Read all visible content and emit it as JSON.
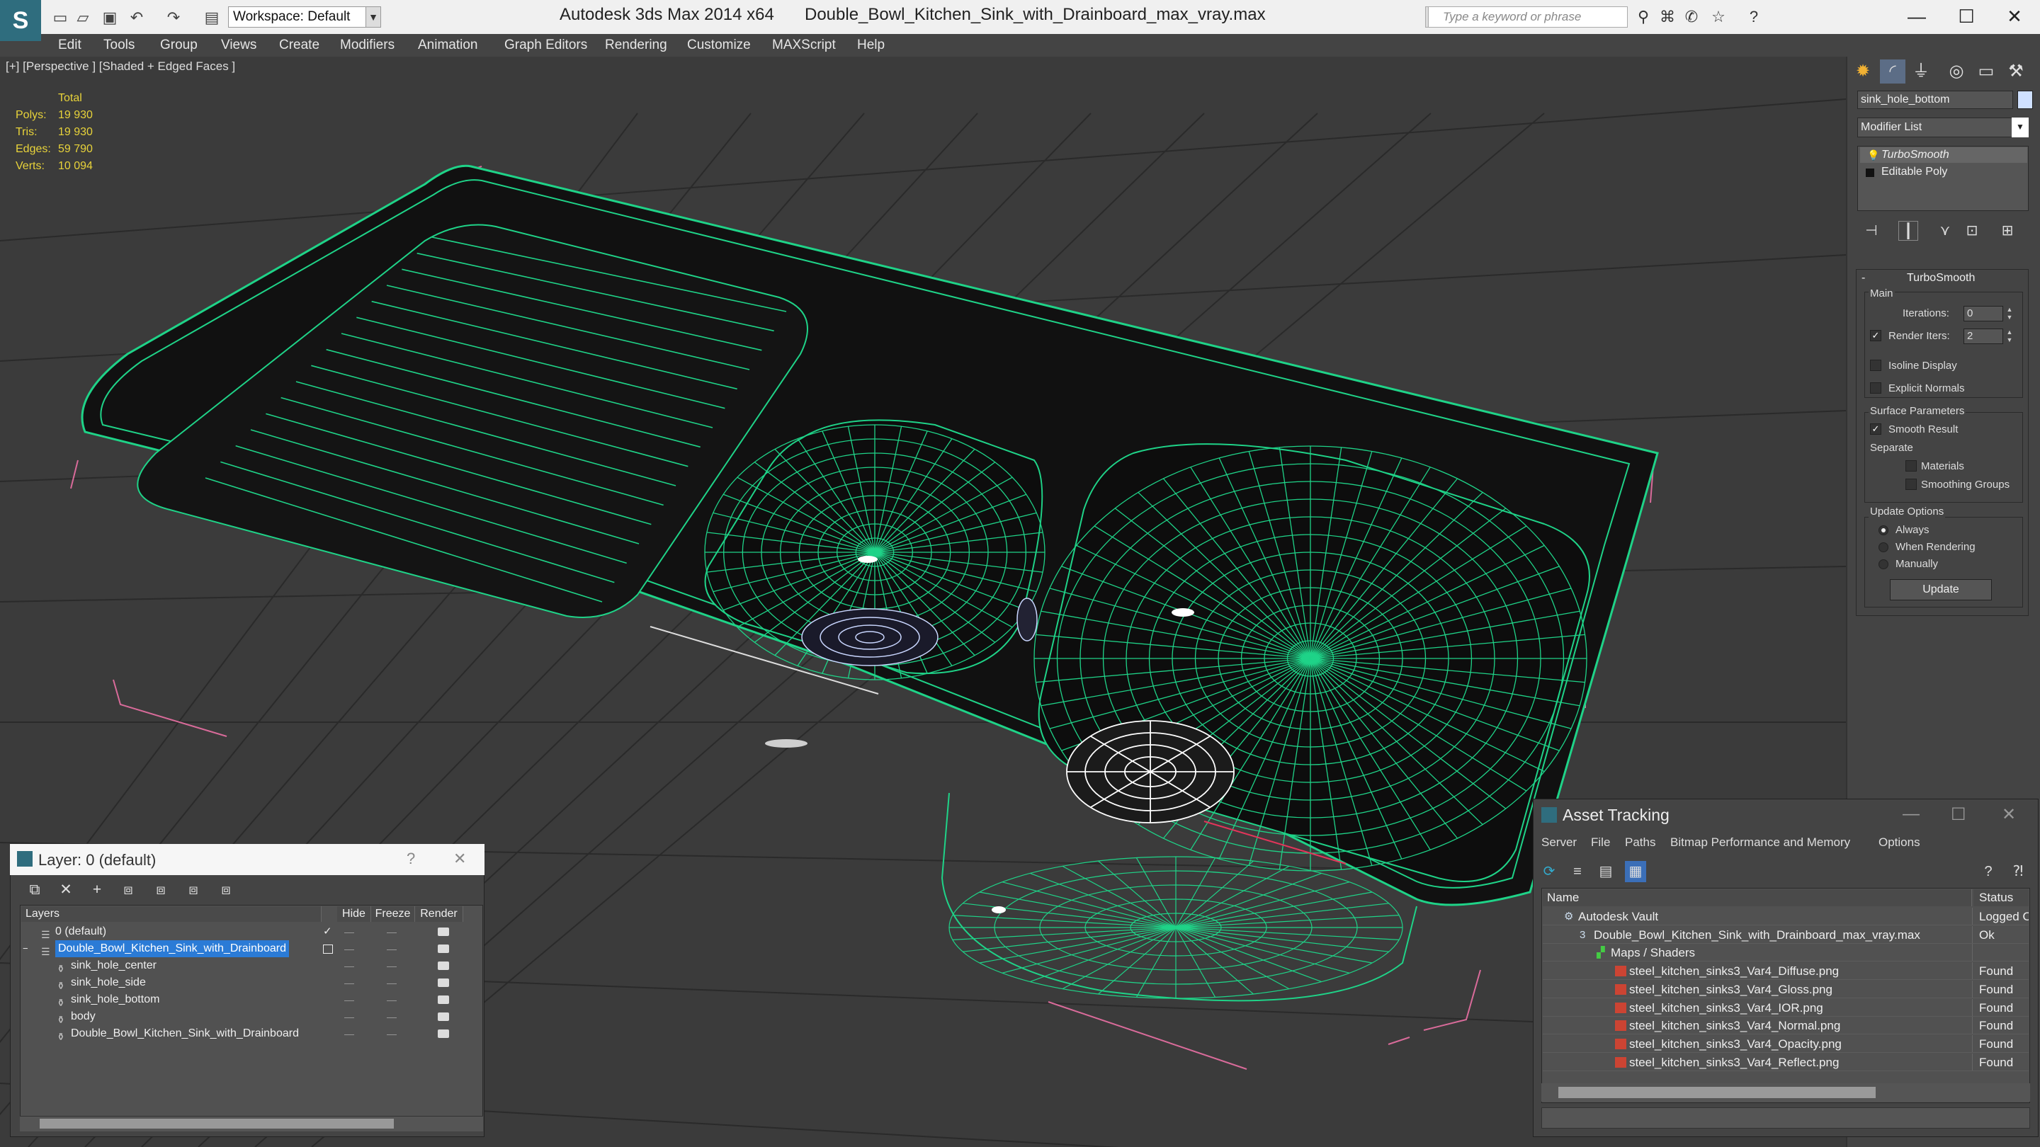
{
  "titlebar": {
    "app_title": "Autodesk 3ds Max  2014 x64",
    "doc_title": "Double_Bowl_Kitchen_Sink_with_Drainboard_max_vray.max",
    "workspace": "Workspace: Default",
    "search_placeholder": "Type a keyword or phrase",
    "logo": "S"
  },
  "menu": [
    "Edit",
    "Tools",
    "Group",
    "Views",
    "Create",
    "Modifiers",
    "Animation",
    "Graph Editors",
    "Rendering",
    "Customize",
    "MAXScript",
    "Help"
  ],
  "viewport": {
    "label": "[+] [Perspective ] [Shaded + Edged Faces ]",
    "stats_header": "Total",
    "stats": [
      {
        "label": "Polys:",
        "value": "19 930"
      },
      {
        "label": "Tris:",
        "value": "19 930"
      },
      {
        "label": "Edges:",
        "value": "59 790"
      },
      {
        "label": "Verts:",
        "value": "10 094"
      }
    ],
    "wire_color": "#1fd388",
    "grid_color": "#2a2a2a",
    "bbox_color": "#d96b9a"
  },
  "command_panel": {
    "object_name": "sink_hole_bottom",
    "modifier_list": "Modifier List",
    "stack": [
      "TurboSmooth",
      "Editable Poly"
    ],
    "rollout_title": "TurboSmooth",
    "main_label": "Main",
    "iterations_label": "Iterations:",
    "iterations_value": "0",
    "render_iters_label": "Render Iters:",
    "render_iters_value": "2",
    "isoline_label": "Isoline Display",
    "explicit_normals_label": "Explicit Normals",
    "surface_params_label": "Surface Parameters",
    "smooth_result_label": "Smooth Result",
    "separate_label": "Separate",
    "materials_label": "Materials",
    "smoothing_groups_label": "Smoothing Groups",
    "update_options_label": "Update Options",
    "always_label": "Always",
    "when_rendering_label": "When Rendering",
    "manually_label": "Manually",
    "update_button": "Update"
  },
  "layer_panel": {
    "title": "Layer: 0 (default)",
    "headers": {
      "layers": "Layers",
      "hide": "Hide",
      "freeze": "Freeze",
      "render": "Render"
    },
    "rows": [
      {
        "name": "0 (default)"
      },
      {
        "name": "Double_Bowl_Kitchen_Sink_with_Drainboard"
      },
      {
        "name": "sink_hole_center"
      },
      {
        "name": "sink_hole_side"
      },
      {
        "name": "sink_hole_bottom"
      },
      {
        "name": "body"
      },
      {
        "name": "Double_Bowl_Kitchen_Sink_with_Drainboard"
      }
    ],
    "dash": "—"
  },
  "asset_panel": {
    "title": "Asset Tracking",
    "menu": [
      "Server",
      "File",
      "Paths",
      "Bitmap Performance and Memory",
      "Options"
    ],
    "headers": {
      "name": "Name",
      "status": "Status"
    },
    "rows": [
      {
        "name": "Autodesk Vault",
        "status": "Logged O"
      },
      {
        "name": "Double_Bowl_Kitchen_Sink_with_Drainboard_max_vray.max",
        "status": "Ok"
      },
      {
        "name": "Maps / Shaders",
        "status": ""
      },
      {
        "name": "steel_kitchen_sinks3_Var4_Diffuse.png",
        "status": "Found"
      },
      {
        "name": "steel_kitchen_sinks3_Var4_Gloss.png",
        "status": "Found"
      },
      {
        "name": "steel_kitchen_sinks3_Var4_IOR.png",
        "status": "Found"
      },
      {
        "name": "steel_kitchen_sinks3_Var4_Normal.png",
        "status": "Found"
      },
      {
        "name": "steel_kitchen_sinks3_Var4_Opacity.png",
        "status": "Found"
      },
      {
        "name": "steel_kitchen_sinks3_Var4_Reflect.png",
        "status": "Found"
      }
    ]
  }
}
